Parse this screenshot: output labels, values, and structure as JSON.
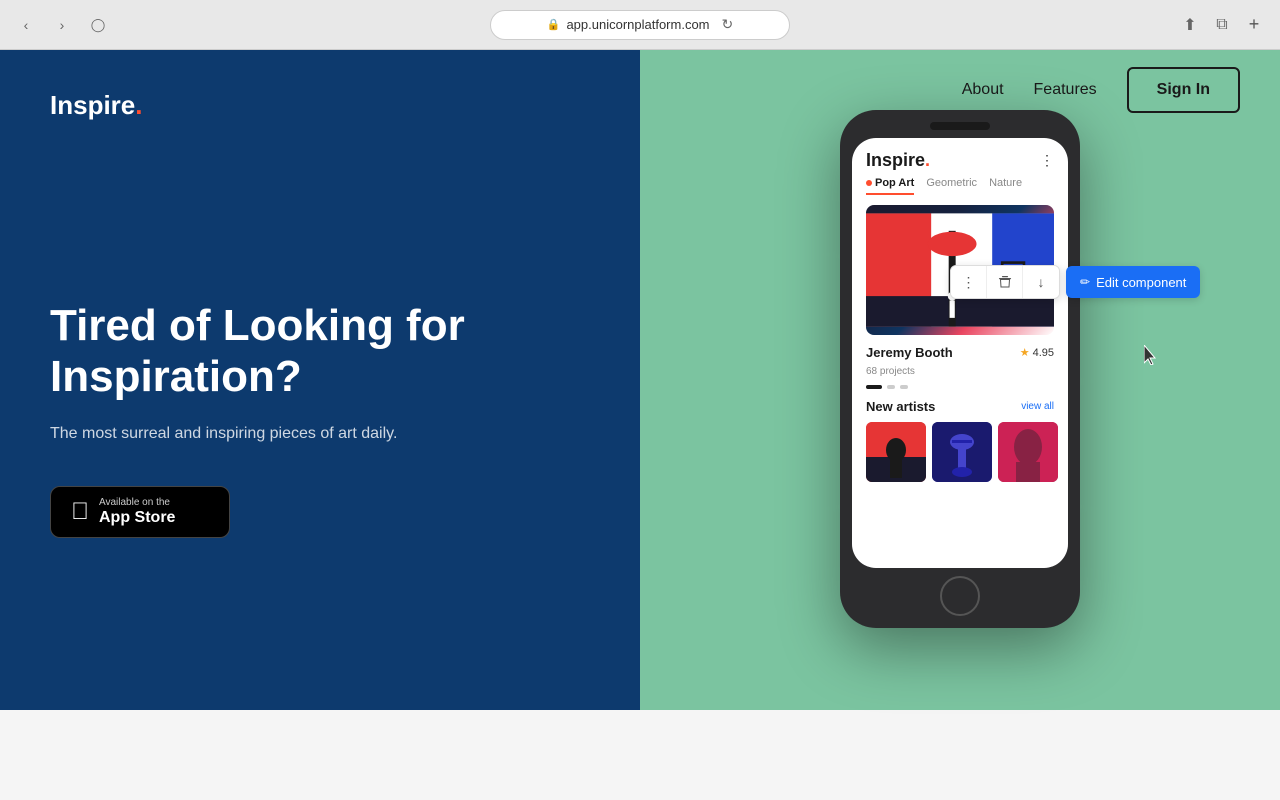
{
  "browser": {
    "url": "app.unicornplatform.com",
    "back_btn": "‹",
    "forward_btn": "›",
    "tab_btn": "⬜",
    "refresh_icon": "↻",
    "share_icon": "⬆",
    "minimize_icon": "⧉",
    "add_tab": "+"
  },
  "nav": {
    "about": "About",
    "features": "Features",
    "sign_in": "Sign In"
  },
  "hero": {
    "logo": "Inspire",
    "heading": "Tired of Looking for Inspiration?",
    "subtext": "The most surreal and inspiring pieces of art daily.",
    "app_store_available": "Available on the",
    "app_store_name": "App Store"
  },
  "phone": {
    "screen_logo": "Inspire",
    "tabs": [
      "Pop Art",
      "Geometric",
      "Nature"
    ],
    "artist_name": "Jeremy Booth",
    "artist_rating": "4.95",
    "artist_projects": "68 projects",
    "section_new_artists": "New artists",
    "view_all": "view all"
  },
  "toolbar": {
    "more_icon": "⋮",
    "delete_icon": "🗑",
    "down_icon": "↓",
    "edit_label": "Edit component"
  }
}
